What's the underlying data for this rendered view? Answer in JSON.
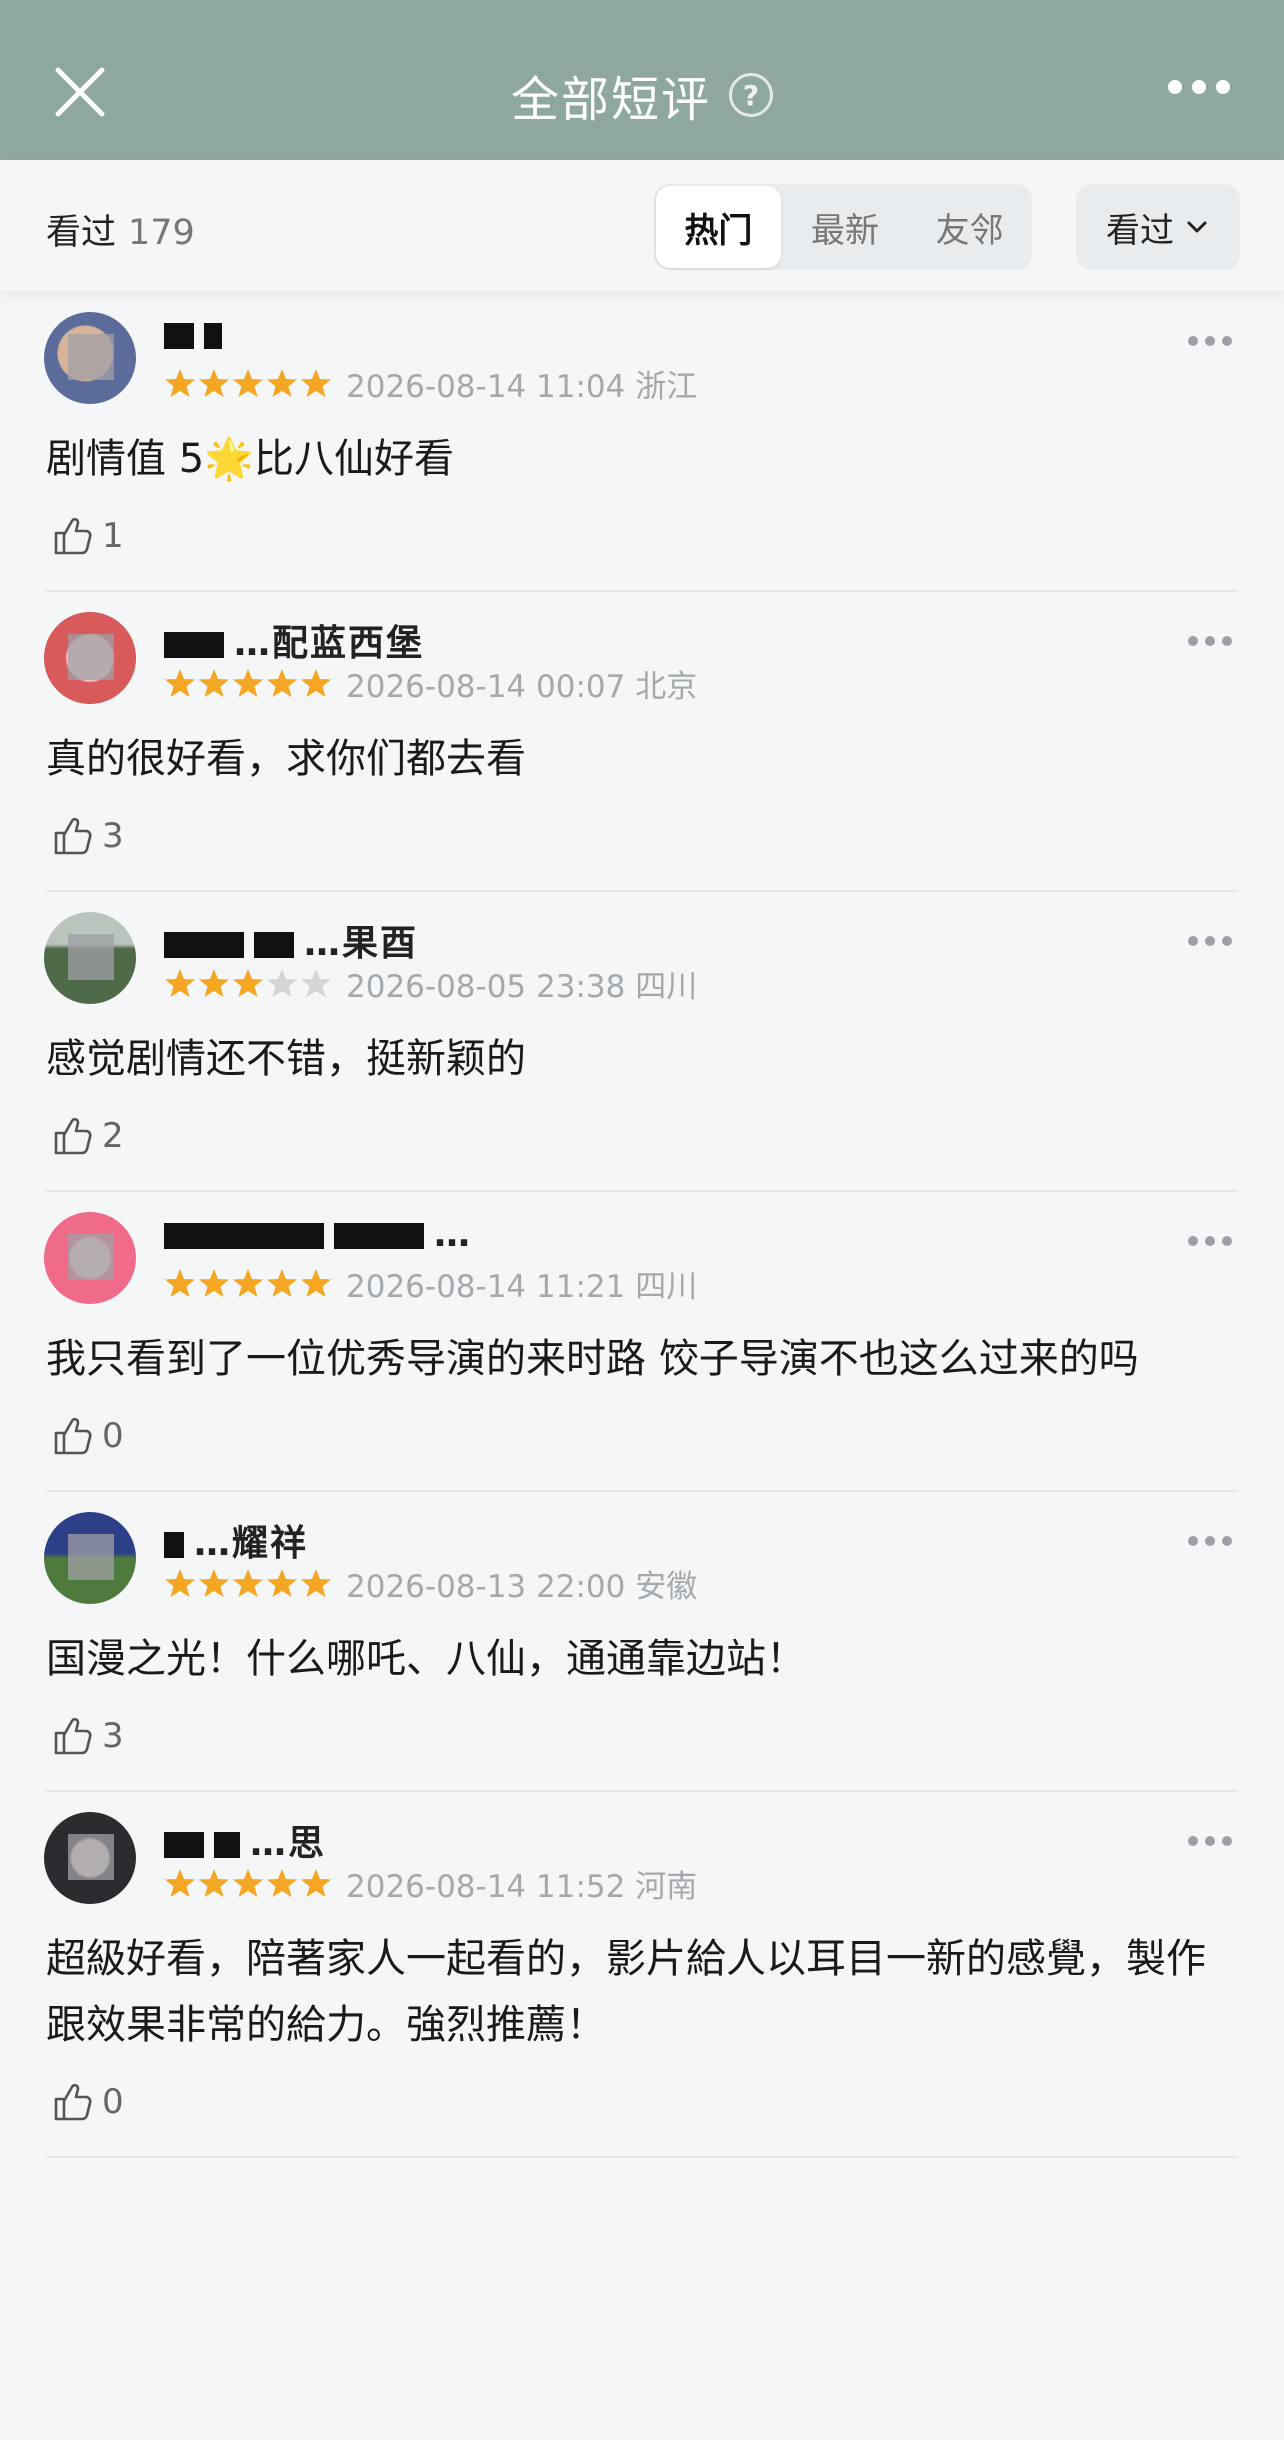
{
  "header": {
    "title": "全部短评",
    "help_icon": "question-circle-icon",
    "close_icon": "close-icon",
    "more_icon": "more-horizontal-icon"
  },
  "filter": {
    "count_label": "看过",
    "count_value": "179",
    "tabs": [
      {
        "label": "热门",
        "active": true
      },
      {
        "label": "最新",
        "active": false
      },
      {
        "label": "友邻",
        "active": false
      }
    ],
    "dropdown_label": "看过"
  },
  "colors": {
    "header_bg": "#8ea79f",
    "star_filled": "#f5a623",
    "star_empty": "#d3d6d9"
  },
  "reviews": [
    {
      "name": "",
      "rating": 5,
      "time": "2026-08-14 11:04 浙江",
      "text": "剧情值 5🌟比八仙好看",
      "likes": "1"
    },
    {
      "name": "…配蓝西堡",
      "rating": 5,
      "time": "2026-08-14 00:07 北京",
      "text": "真的很好看，求你们都去看",
      "likes": "3"
    },
    {
      "name": "…果酉",
      "rating": 3,
      "time": "2026-08-05 23:38 四川",
      "text": "感觉剧情还不错，挺新颖的",
      "likes": "2"
    },
    {
      "name": "…",
      "rating": 5,
      "time": "2026-08-14 11:21 四川",
      "text": "我只看到了一位优秀导演的来时路 饺子导演不也这么过来的吗",
      "likes": "0"
    },
    {
      "name": "…耀祥",
      "rating": 5,
      "time": "2026-08-13 22:00 安徽",
      "text": "国漫之光！什么哪吒、八仙，通通靠边站！",
      "likes": "3"
    },
    {
      "name": "…思",
      "rating": 5,
      "time": "2026-08-14 11:52 河南",
      "text": "超級好看，陪著家人一起看的，影片給人以耳目一新的感覺，製作跟效果非常的給力。強烈推薦！",
      "likes": "0"
    }
  ]
}
